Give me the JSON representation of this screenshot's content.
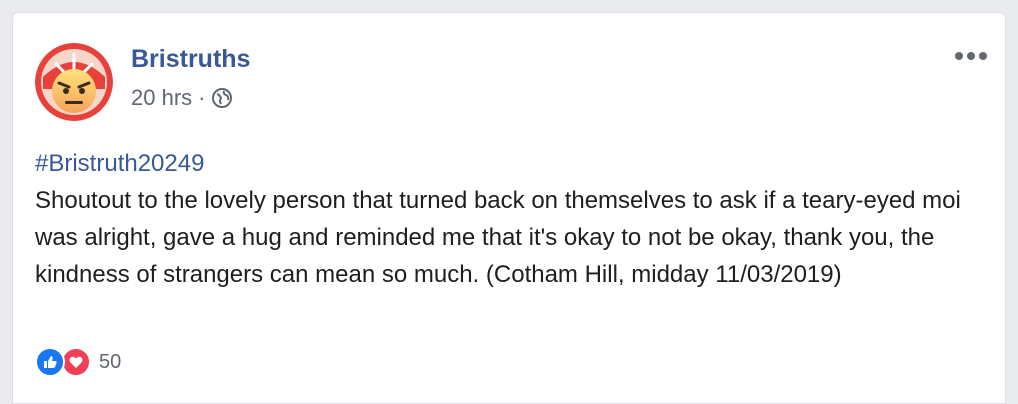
{
  "post": {
    "author": "Bristruths",
    "timestamp": "20 hrs",
    "separator": "·",
    "privacy_icon": "globe-icon",
    "hashtag": "#Bristruth20249",
    "text": "Shoutout to the lovely person that turned back on themselves to ask if a teary-eyed moi was alright, gave a hug and reminded me that it's okay to not be okay, thank you, the kindness of strangers can mean so much. (Cotham Hill, midday 11/03/2019)",
    "reactions": {
      "icons": [
        "like-icon",
        "love-icon"
      ],
      "count": "50"
    }
  },
  "colors": {
    "link": "#385898",
    "meta": "#606770",
    "like": "#1877f2",
    "love": "#f33e58"
  }
}
